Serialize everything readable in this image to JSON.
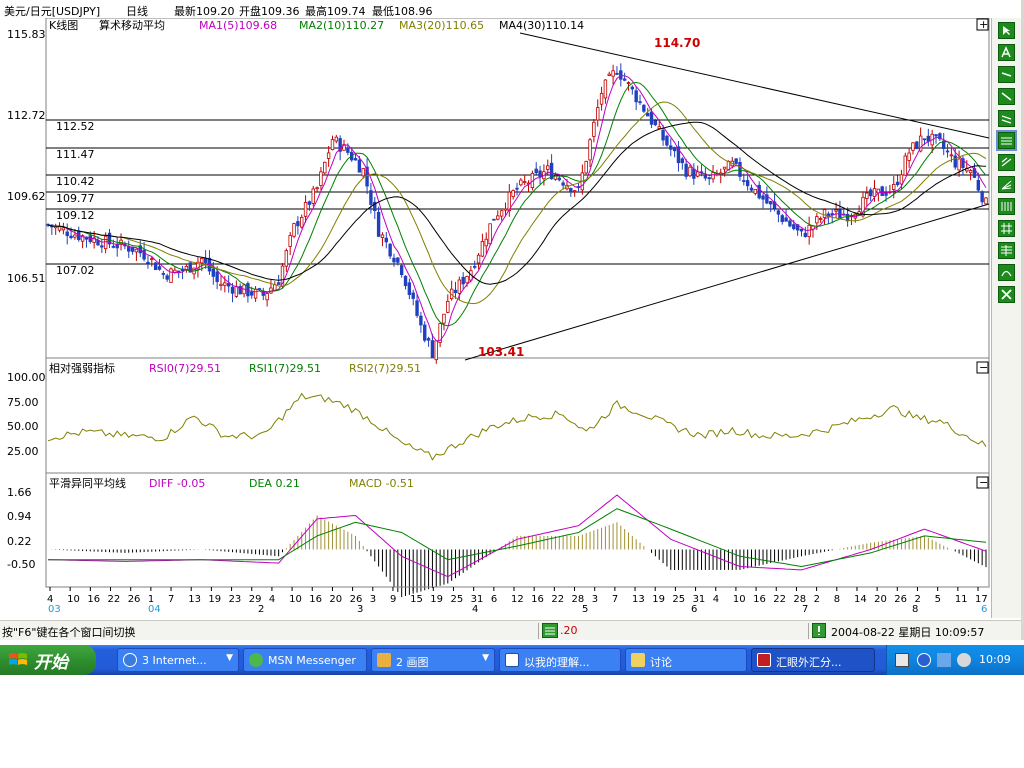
{
  "info": {
    "pair": "美元/日元[USDJPY]",
    "period": "日线",
    "last": "最新109.20",
    "open": "开盘109.36",
    "high": "最高109.74",
    "low": "最低108.96"
  },
  "main_panel": {
    "title": "K线图",
    "indicator_name": "算术移动平均",
    "ma1": "MA1(5)109.68",
    "ma2": "MA2(10)110.27",
    "ma3": "MA3(20)110.65",
    "ma4": "MA4(30)110.14",
    "expand_symbol": "+",
    "y_ticks": [
      "115.83",
      "112.72",
      "109.62",
      "106.51"
    ],
    "level_labels": [
      "112.52",
      "111.47",
      "110.42",
      "109.77",
      "109.12",
      "107.02"
    ],
    "peak_label": "114.70",
    "trough_label": "103.41"
  },
  "rsi_panel": {
    "title": "相对强弱指标",
    "rsi0": "RSI0(7)29.51",
    "rsi1": "RSI1(7)29.51",
    "rsi2": "RSI2(7)29.51",
    "collapse_symbol": "−",
    "y_ticks": [
      "100.00",
      "75.00",
      "50.00",
      "25.00"
    ]
  },
  "macd_panel": {
    "title": "平滑异同平均线",
    "diff": "DIFF -0.05",
    "dea": "DEA 0.21",
    "macd": "MACD -0.51",
    "collapse_symbol": "−",
    "y_ticks": [
      "1.66",
      "0.94",
      "0.22",
      "-0.50"
    ]
  },
  "x_axis": {
    "day_ticks": [
      "4",
      "10",
      "16",
      "22",
      "26",
      "1",
      "7",
      "13",
      "19",
      "23",
      "29",
      "4",
      "10",
      "16",
      "20",
      "26",
      "3",
      "9",
      "15",
      "19",
      "25",
      "31",
      "6",
      "12",
      "16",
      "22",
      "28",
      "3",
      "7",
      "13",
      "19",
      "25",
      "31",
      "4",
      "10",
      "16",
      "22",
      "28",
      "2",
      "8",
      "14",
      "20",
      "26",
      "2",
      "5",
      "11",
      "17"
    ],
    "month_ticks": [
      "03",
      "04",
      "2",
      "3",
      "4",
      "5",
      "6",
      "7",
      "8",
      "6"
    ]
  },
  "status": {
    "hint": "按\"F6\"键在各个窗口间切换",
    "price": ".20",
    "datetime": "2004-08-22 星期日 10:09:57"
  },
  "taskbar": {
    "start": "开始",
    "tasks": [
      {
        "label": "3 Internet..."
      },
      {
        "label": "MSN Messenger"
      },
      {
        "label": "2 画图"
      },
      {
        "label": "以我的理解..."
      },
      {
        "label": "讨论"
      },
      {
        "label": "汇眼外汇分..."
      }
    ],
    "clock": "10:09"
  },
  "colors": {
    "ma1": "#c000c0",
    "ma2": "#008000",
    "ma3": "#808000",
    "ma4": "#000000",
    "candle_up": "#c00000",
    "candle_down": "#2040c0",
    "label_red": "#d00000",
    "accent_blue": "#1e9ad6"
  },
  "chart_data": {
    "type": "candlestick",
    "instrument": "USDJPY",
    "period": "daily",
    "y_range": [
      103.41,
      115.83
    ],
    "annotations": [
      {
        "label": "114.70",
        "type": "peak"
      },
      {
        "label": "103.41",
        "type": "trough"
      }
    ],
    "horizontal_levels": [
      112.52,
      111.47,
      110.42,
      109.77,
      109.12,
      107.02
    ],
    "trend_lines": [
      {
        "name": "resistance",
        "from": 114.7,
        "to": 111.9
      },
      {
        "name": "support",
        "from": 103.41,
        "to": 109.1
      }
    ],
    "close_path": [
      {
        "x": 0,
        "y": 108.5
      },
      {
        "x": 8,
        "y": 108.1
      },
      {
        "x": 16,
        "y": 107.8
      },
      {
        "x": 22,
        "y": 107.6
      },
      {
        "x": 26,
        "y": 107.3
      },
      {
        "x": 30,
        "y": 106.6
      },
      {
        "x": 36,
        "y": 106.8
      },
      {
        "x": 40,
        "y": 107.2
      },
      {
        "x": 44,
        "y": 106.3
      },
      {
        "x": 50,
        "y": 106.0
      },
      {
        "x": 56,
        "y": 105.8
      },
      {
        "x": 60,
        "y": 106.4
      },
      {
        "x": 64,
        "y": 108.4
      },
      {
        "x": 70,
        "y": 109.9
      },
      {
        "x": 74,
        "y": 111.8
      },
      {
        "x": 78,
        "y": 111.3
      },
      {
        "x": 82,
        "y": 110.6
      },
      {
        "x": 86,
        "y": 108.3
      },
      {
        "x": 92,
        "y": 106.8
      },
      {
        "x": 97,
        "y": 104.6
      },
      {
        "x": 100,
        "y": 103.6
      },
      {
        "x": 104,
        "y": 105.6
      },
      {
        "x": 110,
        "y": 106.8
      },
      {
        "x": 116,
        "y": 108.8
      },
      {
        "x": 122,
        "y": 109.9
      },
      {
        "x": 130,
        "y": 110.6
      },
      {
        "x": 138,
        "y": 109.8
      },
      {
        "x": 144,
        "y": 113.6
      },
      {
        "x": 148,
        "y": 114.5
      },
      {
        "x": 154,
        "y": 113.2
      },
      {
        "x": 160,
        "y": 111.8
      },
      {
        "x": 166,
        "y": 110.6
      },
      {
        "x": 172,
        "y": 110.2
      },
      {
        "x": 178,
        "y": 110.8
      },
      {
        "x": 184,
        "y": 109.8
      },
      {
        "x": 190,
        "y": 108.9
      },
      {
        "x": 196,
        "y": 108.1
      },
      {
        "x": 202,
        "y": 108.9
      },
      {
        "x": 208,
        "y": 108.9
      },
      {
        "x": 214,
        "y": 109.6
      },
      {
        "x": 220,
        "y": 109.9
      },
      {
        "x": 224,
        "y": 111.3
      },
      {
        "x": 228,
        "y": 111.9
      },
      {
        "x": 232,
        "y": 111.6
      },
      {
        "x": 236,
        "y": 110.9
      },
      {
        "x": 240,
        "y": 110.6
      },
      {
        "x": 244,
        "y": 109.3
      }
    ],
    "rsi_path": [
      {
        "x": 0,
        "y": 38
      },
      {
        "x": 10,
        "y": 44
      },
      {
        "x": 20,
        "y": 40
      },
      {
        "x": 30,
        "y": 38
      },
      {
        "x": 38,
        "y": 60
      },
      {
        "x": 46,
        "y": 40
      },
      {
        "x": 56,
        "y": 40
      },
      {
        "x": 66,
        "y": 80
      },
      {
        "x": 72,
        "y": 78
      },
      {
        "x": 78,
        "y": 70
      },
      {
        "x": 84,
        "y": 56
      },
      {
        "x": 92,
        "y": 32
      },
      {
        "x": 100,
        "y": 18
      },
      {
        "x": 108,
        "y": 35
      },
      {
        "x": 116,
        "y": 50
      },
      {
        "x": 126,
        "y": 60
      },
      {
        "x": 134,
        "y": 62
      },
      {
        "x": 140,
        "y": 44
      },
      {
        "x": 148,
        "y": 72
      },
      {
        "x": 154,
        "y": 64
      },
      {
        "x": 162,
        "y": 50
      },
      {
        "x": 170,
        "y": 40
      },
      {
        "x": 178,
        "y": 46
      },
      {
        "x": 186,
        "y": 40
      },
      {
        "x": 194,
        "y": 40
      },
      {
        "x": 202,
        "y": 46
      },
      {
        "x": 212,
        "y": 58
      },
      {
        "x": 220,
        "y": 68
      },
      {
        "x": 226,
        "y": 58
      },
      {
        "x": 232,
        "y": 55
      },
      {
        "x": 238,
        "y": 42
      },
      {
        "x": 244,
        "y": 29.51
      }
    ],
    "macd": {
      "diff_path": [
        {
          "x": 0,
          "y": -0.3
        },
        {
          "x": 20,
          "y": -0.35
        },
        {
          "x": 40,
          "y": -0.3
        },
        {
          "x": 60,
          "y": -0.4
        },
        {
          "x": 70,
          "y": 0.9
        },
        {
          "x": 80,
          "y": 1.0
        },
        {
          "x": 92,
          "y": -0.2
        },
        {
          "x": 104,
          "y": -0.8
        },
        {
          "x": 122,
          "y": 0.3
        },
        {
          "x": 138,
          "y": 0.7
        },
        {
          "x": 148,
          "y": 1.6
        },
        {
          "x": 162,
          "y": 0.3
        },
        {
          "x": 180,
          "y": -0.5
        },
        {
          "x": 196,
          "y": -0.6
        },
        {
          "x": 214,
          "y": 0.0
        },
        {
          "x": 228,
          "y": 0.6
        },
        {
          "x": 244,
          "y": -0.05
        }
      ],
      "dea_path": [
        {
          "x": 0,
          "y": -0.3
        },
        {
          "x": 20,
          "y": -0.3
        },
        {
          "x": 40,
          "y": -0.3
        },
        {
          "x": 60,
          "y": -0.3
        },
        {
          "x": 70,
          "y": 0.4
        },
        {
          "x": 80,
          "y": 0.8
        },
        {
          "x": 92,
          "y": 0.5
        },
        {
          "x": 104,
          "y": -0.3
        },
        {
          "x": 122,
          "y": 0.1
        },
        {
          "x": 138,
          "y": 0.5
        },
        {
          "x": 148,
          "y": 1.2
        },
        {
          "x": 162,
          "y": 0.6
        },
        {
          "x": 180,
          "y": -0.2
        },
        {
          "x": 196,
          "y": -0.5
        },
        {
          "x": 214,
          "y": -0.1
        },
        {
          "x": 228,
          "y": 0.4
        },
        {
          "x": 244,
          "y": 0.21
        }
      ]
    }
  }
}
